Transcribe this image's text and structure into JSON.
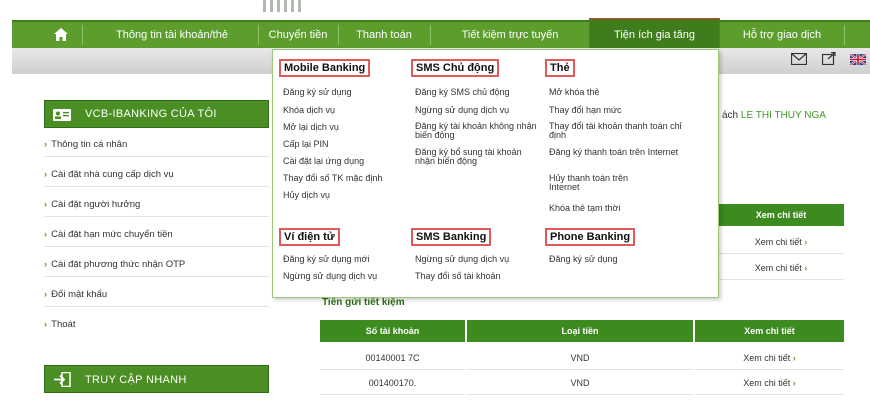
{
  "nav": {
    "items": [
      "Thông tin tài khoản/thẻ",
      "Chuyển tiền",
      "Thanh toán",
      "Tiết kiệm trực tuyến",
      "Tiện ích gia tăng",
      "Hỗ trợ giao dịch"
    ]
  },
  "sidebar": {
    "title": "VCB-IBANKING CỦA TÔI",
    "items": [
      "Thông tin cá nhân",
      "Cài đặt nhà cung cấp dịch vụ",
      "Cài đặt người hưởng",
      "Cài đặt hạn mức chuyển tiền",
      "Cài đặt phương thức nhận OTP",
      "Đổi mật khẩu",
      "Thoát"
    ],
    "quick_title": "TRUY CẬP NHANH"
  },
  "main": {
    "greeting_suffix": "ách",
    "user_name": "LE THI THUY NGA",
    "view_detail_header": "Xem chi tiết",
    "view_detail_link": "Xem chi tiết",
    "savings_title": "Tiền gửi tiết kiệm",
    "table": {
      "headers": [
        "Số tài khoản",
        "Loại tiền",
        "Xem chi tiết"
      ],
      "rows": [
        {
          "account": "00140001 7C",
          "currency": "VND",
          "link": "Xem chi tiết"
        },
        {
          "account": "001400170.",
          "currency": "VND",
          "link": "Xem chi tiết"
        }
      ]
    }
  },
  "dropdown": {
    "mobile_banking": {
      "title": "Mobile Banking",
      "items": [
        "Đăng ký sử dụng",
        "Khóa dịch vụ",
        "Mở lại dịch vụ",
        "Cấp lại PIN",
        "Cài đặt lại ứng dụng",
        "Thay đổi số TK mặc định",
        "Hủy dịch vụ"
      ]
    },
    "sms_chu_dong": {
      "title": "SMS Chủ động",
      "items": [
        "Đăng ký SMS chủ động",
        "Ngừng sử dụng dịch vụ",
        "Đăng ký tài khoản không nhận biến động",
        "Đăng ký bổ sung tài khoản nhận biến động"
      ]
    },
    "the": {
      "title": "Thẻ",
      "items": [
        "Mở khóa thẻ",
        "Thay đổi hạn mức",
        "Thay đổi tài khoản thanh toán chỉ định",
        "Đăng ký thanh toán trên Internet",
        "Hủy thanh toán trên Internet",
        "Khóa thẻ tạm thời"
      ]
    },
    "vi_dien_tu": {
      "title": "Ví điện tử",
      "items": [
        "Đăng ký sử dụng mới",
        "Ngừng sử dụng dịch vụ"
      ]
    },
    "sms_banking": {
      "title": "SMS Banking",
      "items": [
        "Ngừng sử dụng dịch vụ",
        "Thay đổi số tài khoản"
      ]
    },
    "phone_banking": {
      "title": "Phone Banking",
      "items": [
        "Đăng ký sử dụng"
      ]
    }
  },
  "icons": [
    "home-icon",
    "mail-icon",
    "share-icon",
    "uk-flag-icon",
    "user-card-icon",
    "login-icon"
  ],
  "colors": {
    "nav_green": "#5c9d2e",
    "dark_green": "#3f7d1c",
    "highlight_red": "#d23b3b"
  }
}
